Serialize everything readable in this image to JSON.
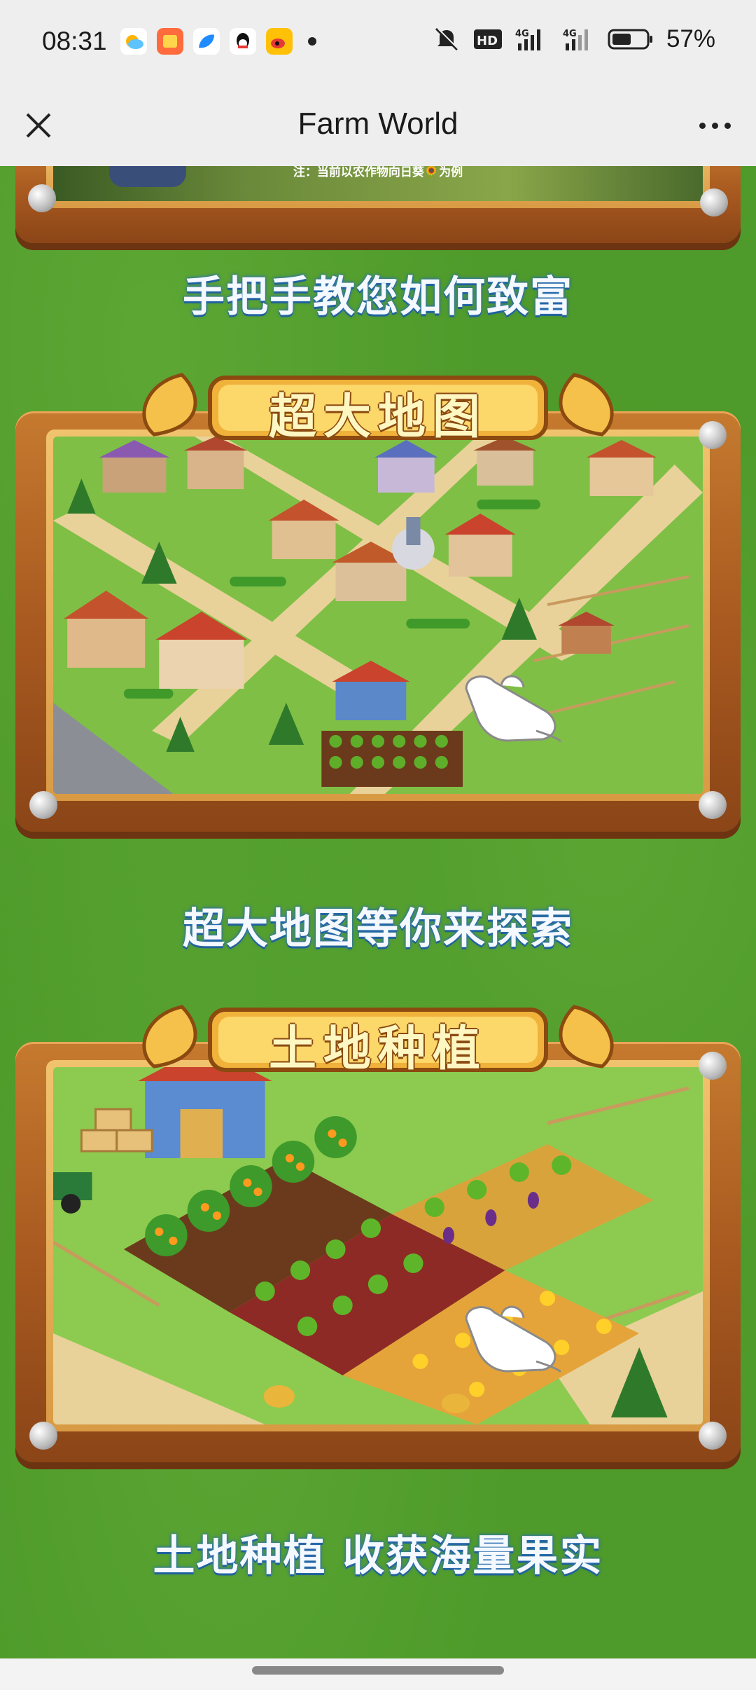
{
  "status_bar": {
    "time": "08:31",
    "battery_percent": "57%",
    "battery_level": 0.57,
    "app_icons": [
      "weather-icon",
      "app-store-icon",
      "browser-icon",
      "qq-icon",
      "weibo-icon"
    ],
    "network": [
      "4G",
      "4G"
    ]
  },
  "title_bar": {
    "title": "Farm World"
  },
  "sections": {
    "top_note": "注：当前以农作物向日葵🌻为例",
    "top_caption": "手把手教您如何致富",
    "map": {
      "header": "超大地图",
      "caption": "超大地图等你来探索"
    },
    "planting": {
      "header": "土地种植",
      "caption": "土地种植 收获海量果实"
    }
  },
  "colors": {
    "background_green": "#4e9a2a",
    "wood": "#b5662a",
    "caption_text": "#f4f8ff",
    "badge_text": "#fff7c2"
  }
}
